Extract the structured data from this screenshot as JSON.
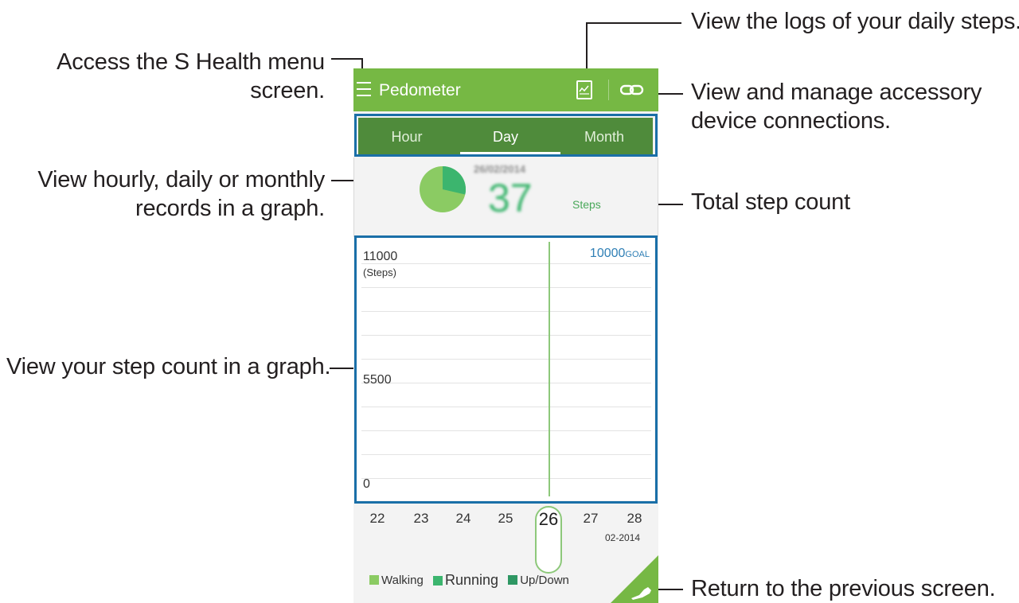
{
  "annotations": {
    "logs": "View the logs of your daily steps.",
    "menu_line1": "Access the S Health menu",
    "menu_line2": "screen.",
    "accessory_line1": "View and manage accessory",
    "accessory_line2": "device connections.",
    "records_line1": "View hourly, daily or monthly",
    "records_line2": "records in a graph.",
    "total": "Total step count",
    "graph": "View your step count in a graph.",
    "back": "Return to the previous screen."
  },
  "app": {
    "title": "Pedometer",
    "icons": {
      "menu": "menu-icon",
      "logs": "logs-icon",
      "accessory": "link-icon",
      "back": "shoe-icon"
    }
  },
  "tabs": [
    {
      "label": "Hour",
      "selected": false
    },
    {
      "label": "Day",
      "selected": true
    },
    {
      "label": "Month",
      "selected": false
    }
  ],
  "summary": {
    "date": "26/02/2014",
    "steps": "37",
    "unit": "Steps"
  },
  "graph": {
    "y_max": "11000",
    "y_unit": "(Steps)",
    "y_mid": "5500",
    "y_min": "0",
    "goal_value": "10000",
    "goal_label": "GOAL"
  },
  "dates": {
    "days": [
      "22",
      "23",
      "24",
      "25",
      "26",
      "27",
      "28"
    ],
    "selected": "26",
    "month_year": "02-2014"
  },
  "legend": {
    "walking": "Walking",
    "running": "Running",
    "updown": "Up/Down"
  },
  "colors": {
    "accent": "#76b844",
    "tabbar": "#4f8b3b",
    "walking": "#8bcb63",
    "running": "#3cb56e",
    "updown": "#2e9763",
    "goal": "#2f7fb5",
    "outline": "#1a6fa8"
  }
}
